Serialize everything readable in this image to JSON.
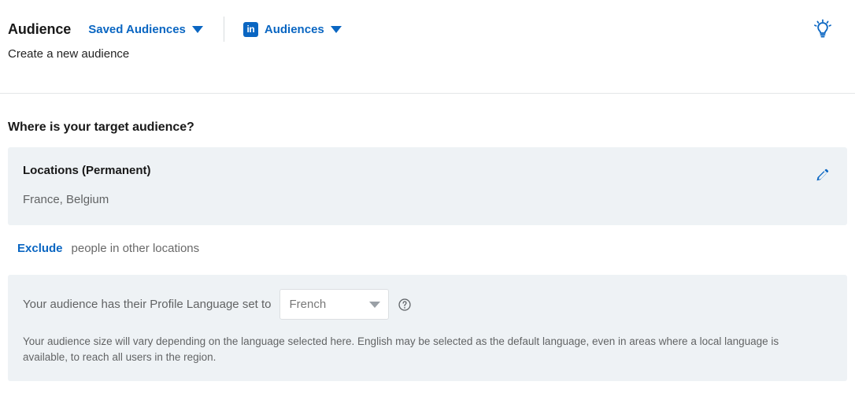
{
  "header": {
    "title": "Audience",
    "saved_audiences_label": "Saved Audiences",
    "linkedin_logo_text": "in",
    "audiences_label": "Audiences",
    "tips_icon": "lightbulb-icon"
  },
  "subtitle": "Create a new audience",
  "section": {
    "heading": "Where is your target audience?",
    "locations_card": {
      "title": "Locations (Permanent)",
      "value": "France, Belgium",
      "edit_icon": "pencil-icon"
    },
    "exclude": {
      "link_label": "Exclude",
      "text": "people in other locations"
    },
    "language_card": {
      "label": "Your audience has their Profile Language set to",
      "selected_value": "French",
      "dropdown_icon": "chevron-down-icon",
      "help_icon": "question-circle-icon",
      "note": "Your audience size will vary depending on the language selected here. English may be selected as the default language, even in areas where a local language is available, to reach all users in the region."
    }
  },
  "colors": {
    "brand_blue": "#0a66c2",
    "card_bg": "#eef2f5",
    "text_primary": "#000000e6",
    "text_secondary": "#00000099",
    "divider": "#e4e6e8"
  }
}
